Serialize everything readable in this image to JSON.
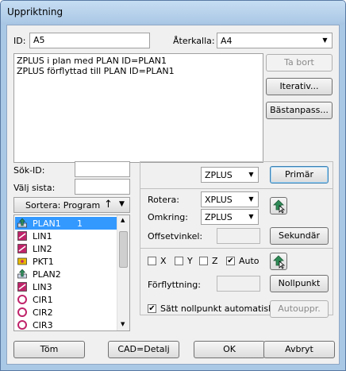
{
  "window": {
    "title": "Uppriktning"
  },
  "id_field": {
    "label": "ID:",
    "value": "A5"
  },
  "recall": {
    "label": "Återkalla:",
    "value": "A4"
  },
  "log": {
    "lines": [
      "ZPLUS i plan med PLAN ID=PLAN1",
      "ZPLUS förflyttad till PLAN ID=PLAN1"
    ]
  },
  "side_buttons": {
    "remove": "Ta bort",
    "iterative": "Iterativ...",
    "bestfit": "Bästanpass..."
  },
  "search": {
    "label": "Sök-ID:",
    "value": ""
  },
  "select_last": {
    "label": "Välj sista:",
    "value": ""
  },
  "sort": {
    "label": "Sortera: Program",
    "arrow_up": "↑",
    "arrow_down": "▼"
  },
  "features": [
    {
      "name": "PLAN1",
      "num": "1",
      "icon": "plane-arrow-icon",
      "selected": true
    },
    {
      "name": "LIN1",
      "num": "",
      "icon": "line-icon",
      "selected": false
    },
    {
      "name": "LIN2",
      "num": "",
      "icon": "line-icon",
      "selected": false
    },
    {
      "name": "PKT1",
      "num": "",
      "icon": "point-icon",
      "selected": false
    },
    {
      "name": "PLAN2",
      "num": "",
      "icon": "plane-arrow-icon",
      "selected": false
    },
    {
      "name": "LIN3",
      "num": "",
      "icon": "line-icon",
      "selected": false
    },
    {
      "name": "CIR1",
      "num": "",
      "icon": "circle-icon",
      "selected": false
    },
    {
      "name": "CIR2",
      "num": "",
      "icon": "circle-icon",
      "selected": false
    },
    {
      "name": "CIR3",
      "num": "",
      "icon": "circle-icon",
      "selected": false
    }
  ],
  "primary": {
    "axis": "ZPLUS",
    "button": "Primär"
  },
  "rotate": {
    "label": "Rotera:",
    "axis": "XPLUS",
    "about_label": "Omkring:",
    "about_axis": "ZPLUS",
    "offset_label": "Offsetvinkel:",
    "offset_value": "",
    "button": "Sekundär"
  },
  "origin": {
    "x": "X",
    "y": "Y",
    "z": "Z",
    "auto": "Auto",
    "x_checked": false,
    "y_checked": false,
    "z_checked": false,
    "auto_checked": true,
    "move_label": "Förflyttning:",
    "move_value": "",
    "button": "Nollpunkt"
  },
  "auto_origin": {
    "label": "Sätt nollpunkt automatiskt",
    "checked": true,
    "button": "Autouppr."
  },
  "footer": {
    "clear": "Töm",
    "cad": "CAD=Detalj",
    "ok": "OK",
    "cancel": "Avbryt"
  },
  "colors": {
    "selection": "#3399ff",
    "titlebar": "#a9c8e6",
    "icon_green": "#2e8b57",
    "icon_pink": "#c0246a",
    "icon_yellow": "#e6b800"
  }
}
